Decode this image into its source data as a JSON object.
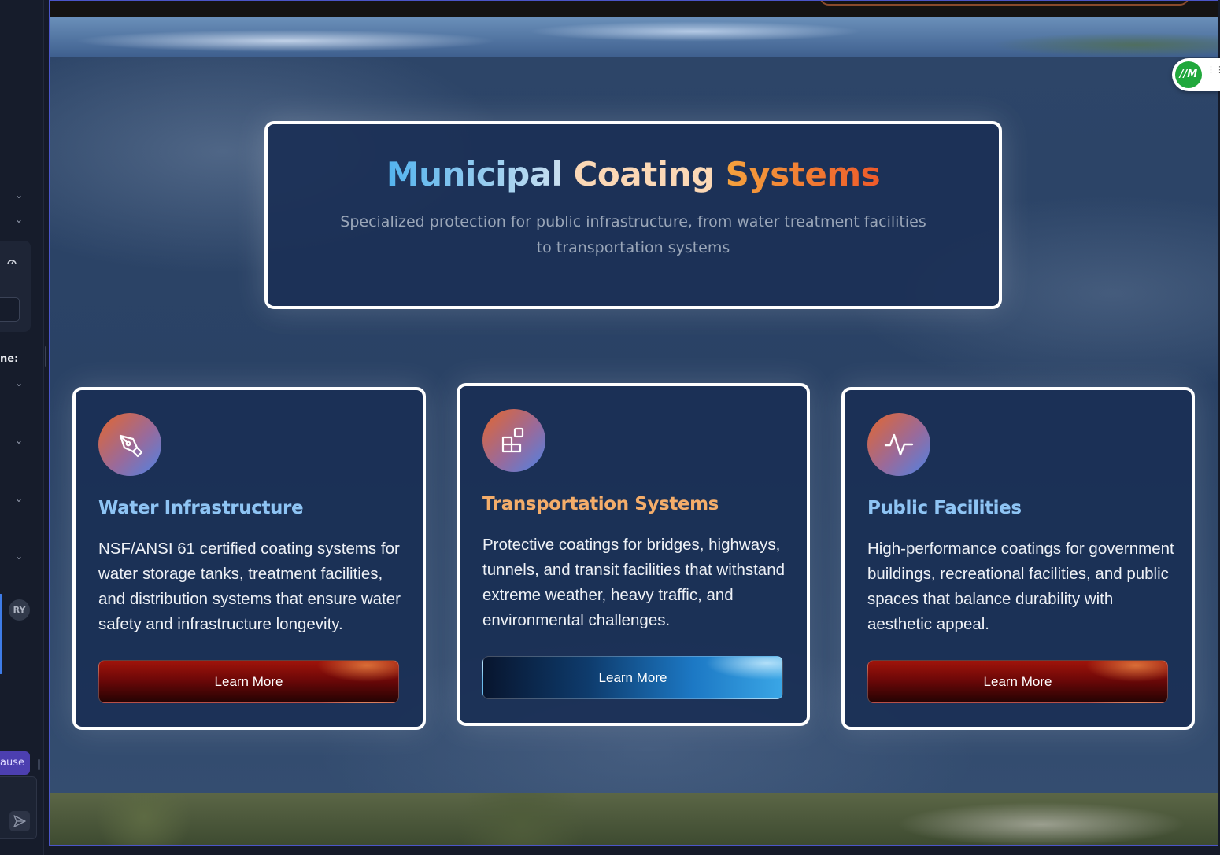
{
  "sidebar": {
    "label_fragment": "ne:",
    "avatar_initials": "RY",
    "pause_fragment": "ause"
  },
  "header": {
    "title_word1": "Municipal",
    "title_word2": "Coating",
    "title_word3": "Systems",
    "subtitle": "Specialized protection for public infrastructure, from water treatment facilities to transportation systems"
  },
  "cards": [
    {
      "icon": "pen-tool-icon",
      "title": "Water Infrastructure",
      "description": "NSF/ANSI 61 certified coating systems for water storage tanks, treatment facilities, and distribution systems that ensure water safety and infrastructure longevity.",
      "button_label": "Learn More"
    },
    {
      "icon": "blocks-icon",
      "title": "Transportation Systems",
      "description": "Protective coatings for bridges, highways, tunnels, and transit facilities that withstand extreme weather, heavy traffic, and environmental challenges.",
      "button_label": "Learn More"
    },
    {
      "icon": "activity-icon",
      "title": "Public Facilities",
      "description": "High-performance coatings for government buildings, recreational facilities, and public spaces that balance durability with aesthetic appeal.",
      "button_label": "Learn More"
    }
  ],
  "widget": {
    "logo_text": "//M"
  },
  "colors": {
    "title_blue": "#8ec4f4",
    "title_orange": "#f4ad6a",
    "button_red": "#a0140a",
    "button_blue": "#1c78c4",
    "frame_border": "#4b55c8"
  }
}
